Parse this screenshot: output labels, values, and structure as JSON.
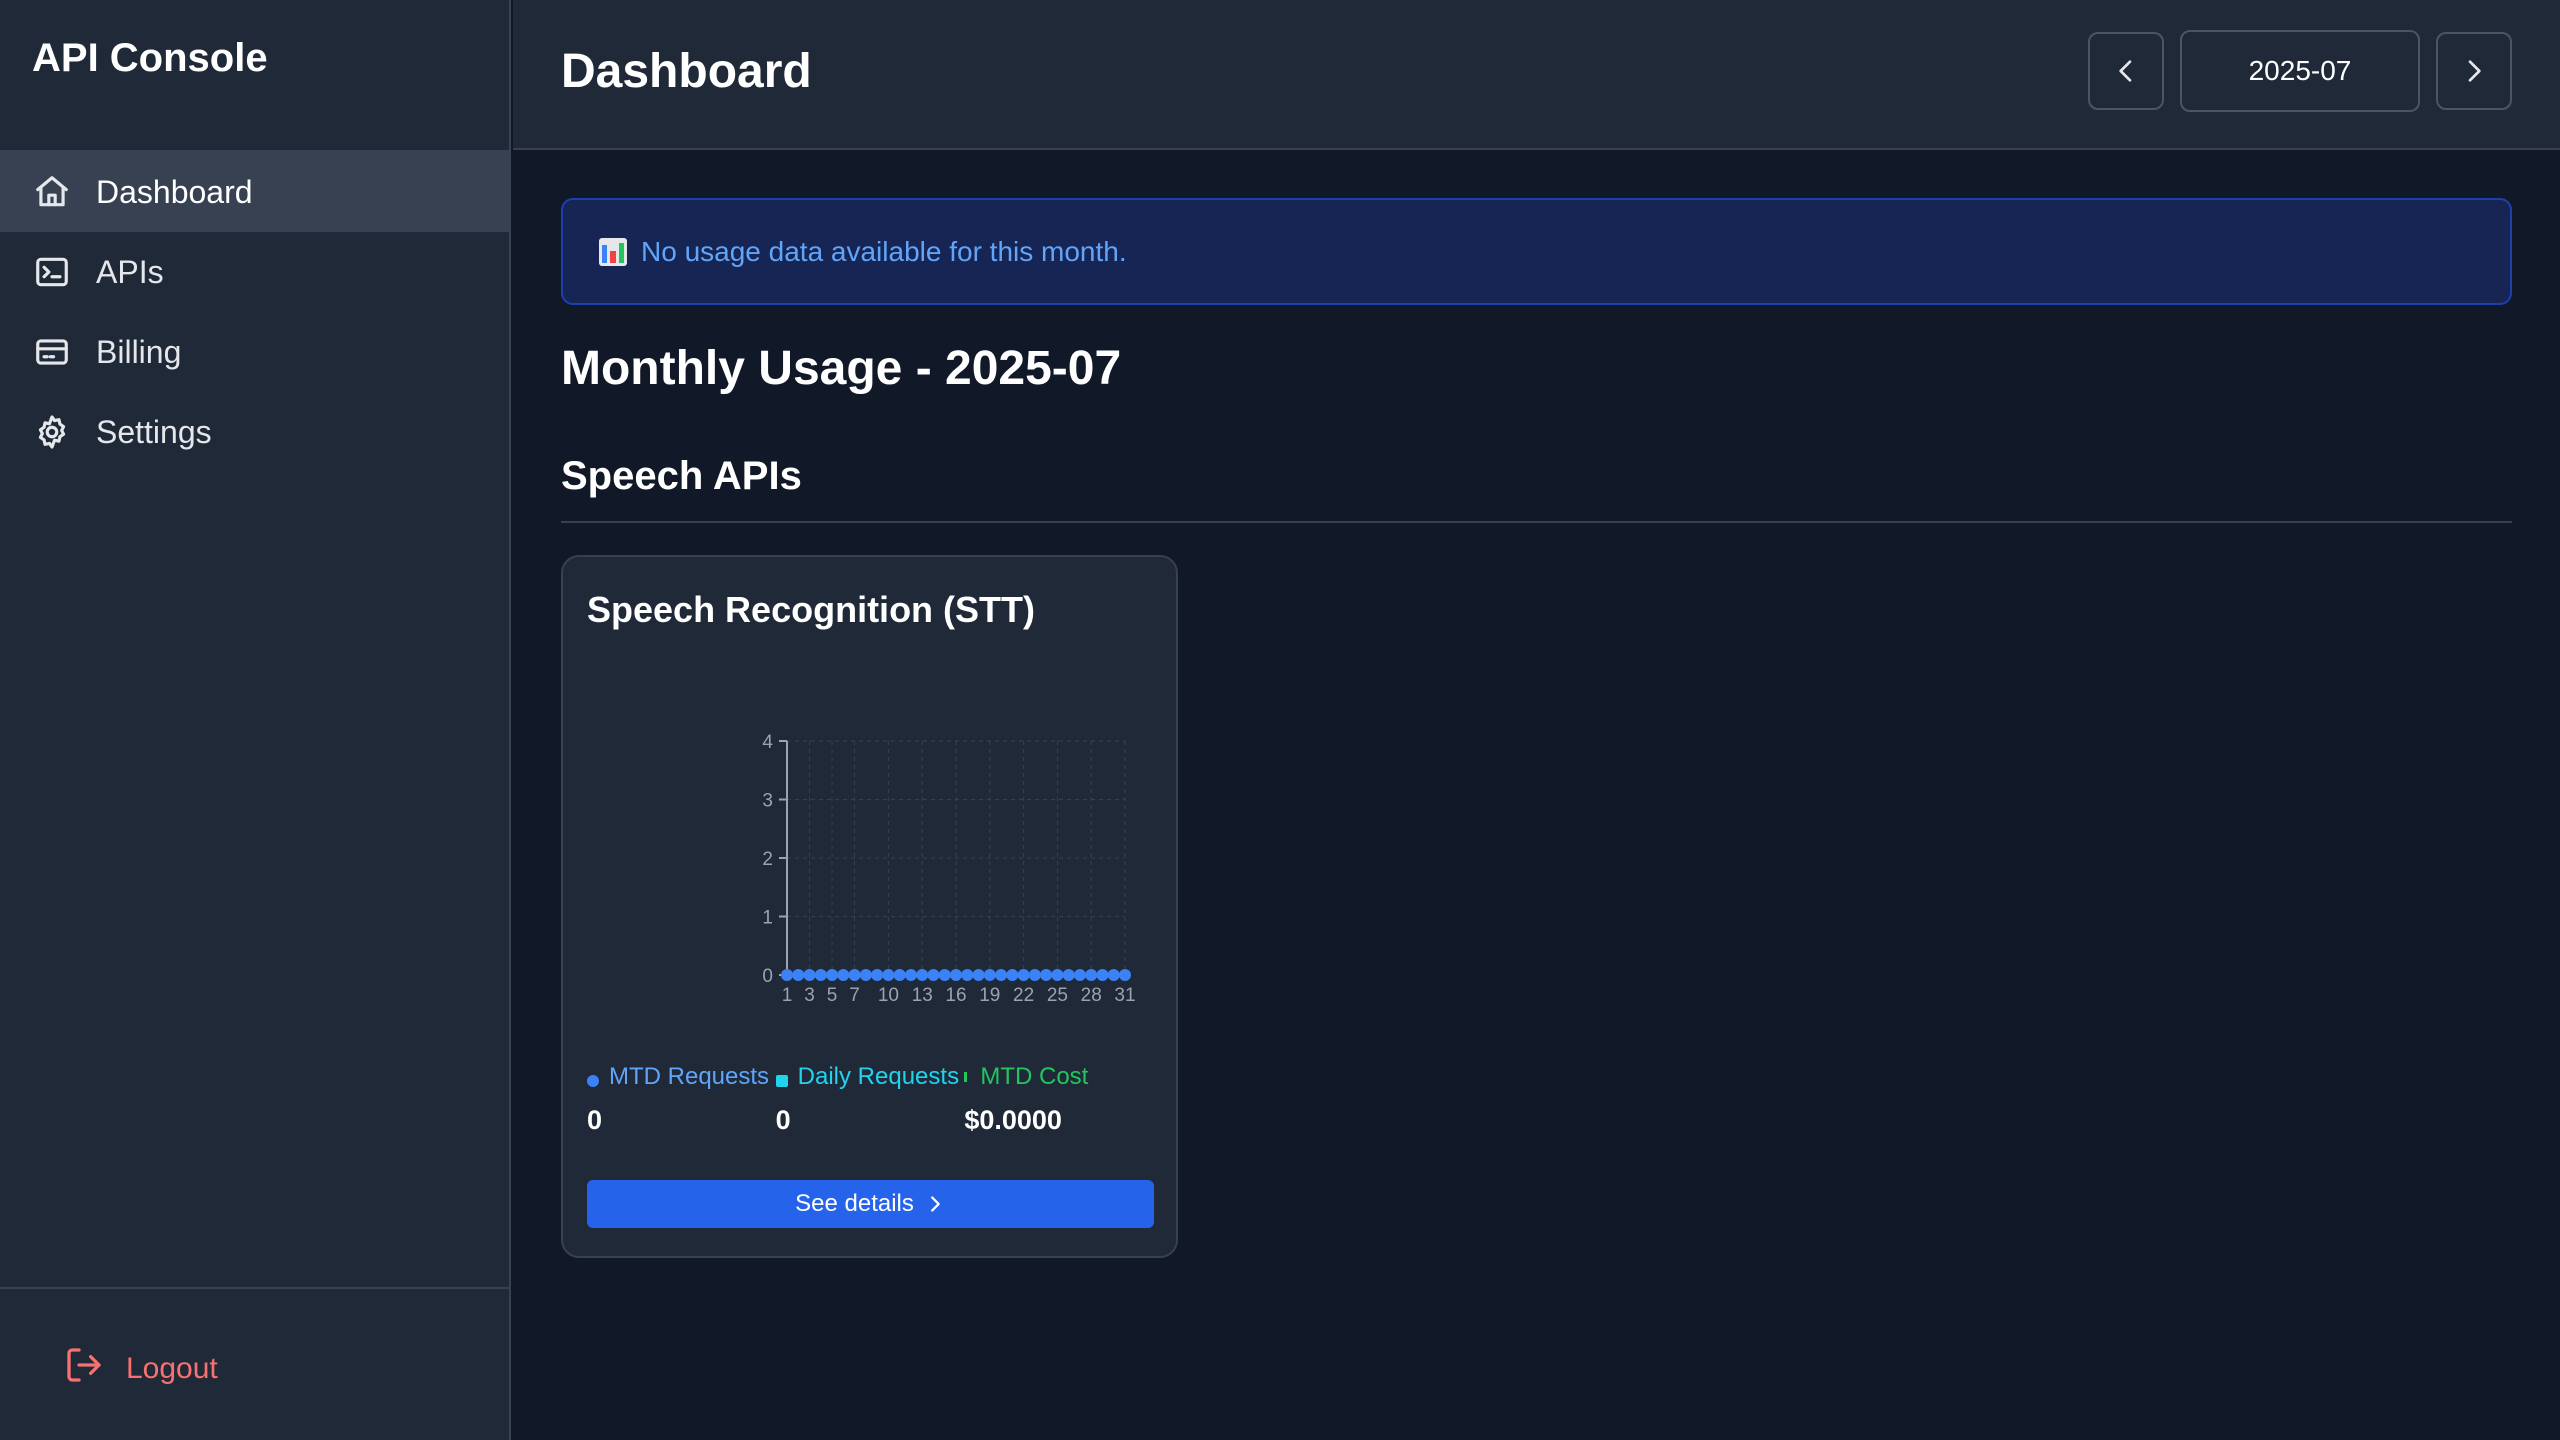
{
  "sidebar": {
    "brand": "API Console",
    "items": [
      {
        "label": "Dashboard",
        "icon": "home-icon",
        "active": true
      },
      {
        "label": "APIs",
        "icon": "terminal-icon",
        "active": false
      },
      {
        "label": "Billing",
        "icon": "credit-card-icon",
        "active": false
      },
      {
        "label": "Settings",
        "icon": "gear-icon",
        "active": false
      }
    ],
    "logout_label": "Logout"
  },
  "header": {
    "title": "Dashboard",
    "month": "2025-07"
  },
  "main": {
    "alert_text": "No usage data available for this month.",
    "usage_title": "Monthly Usage - 2025-07",
    "section_title": "Speech APIs",
    "card": {
      "title": "Speech Recognition (STT)",
      "stats": [
        {
          "label": "MTD Requests",
          "value": "0",
          "color": "#3b82f6"
        },
        {
          "label": "Daily Requests",
          "value": "0",
          "color": "#22d3ee"
        },
        {
          "label": "MTD Cost",
          "value": "$0.0000",
          "color": "#22c55e"
        }
      ],
      "details_label": "See details"
    }
  },
  "colors": {
    "accent": "#2563eb",
    "series": "#3b82f6",
    "logout": "#f87171"
  },
  "chart_data": {
    "type": "line",
    "x": [
      1,
      2,
      3,
      4,
      5,
      6,
      7,
      8,
      9,
      10,
      11,
      12,
      13,
      14,
      15,
      16,
      17,
      18,
      19,
      20,
      21,
      22,
      23,
      24,
      25,
      26,
      27,
      28,
      29,
      30,
      31
    ],
    "x_tick_labels": [
      "1",
      "3",
      "5",
      "7",
      "10",
      "13",
      "16",
      "19",
      "22",
      "25",
      "28",
      "31"
    ],
    "series": [
      {
        "values": [
          0,
          0,
          0,
          0,
          0,
          0,
          0,
          0,
          0,
          0,
          0,
          0,
          0,
          0,
          0,
          0,
          0,
          0,
          0,
          0,
          0,
          0,
          0,
          0,
          0,
          0,
          0,
          0,
          0,
          0,
          0
        ]
      }
    ],
    "ylim": [
      0,
      4
    ],
    "y_ticks": [
      "0",
      "1",
      "2",
      "3",
      "4"
    ],
    "grid": true
  }
}
